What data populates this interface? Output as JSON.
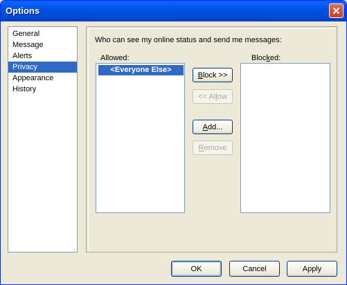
{
  "window": {
    "title": "Options"
  },
  "nav": {
    "items": [
      "General",
      "Message",
      "Alerts",
      "Privacy",
      "Appearance",
      "History"
    ],
    "selected_index": 3
  },
  "privacy": {
    "header": "Who can see my online status and send me messages:",
    "allowed": {
      "label_pre": "Allowed:",
      "items": [
        "<Everyone Else>"
      ]
    },
    "blocked": {
      "label_pre": "Bloc",
      "label_u": "k",
      "label_post": "ed:",
      "items": []
    },
    "block_button": {
      "u": "B",
      "rest": "lock >>"
    },
    "allow_button": {
      "pre": "<< Al",
      "u": "l",
      "post": "ow",
      "enabled": false
    },
    "add_button": {
      "u": "A",
      "rest": "dd..."
    },
    "remove_button": {
      "u": "R",
      "rest": "emove",
      "enabled": false
    }
  },
  "footer": {
    "ok": "OK",
    "cancel": "Cancel",
    "apply": "Apply"
  },
  "colors": {
    "selection": "#316ac5",
    "titlebar": "#0053e0",
    "face": "#ece9d8"
  }
}
